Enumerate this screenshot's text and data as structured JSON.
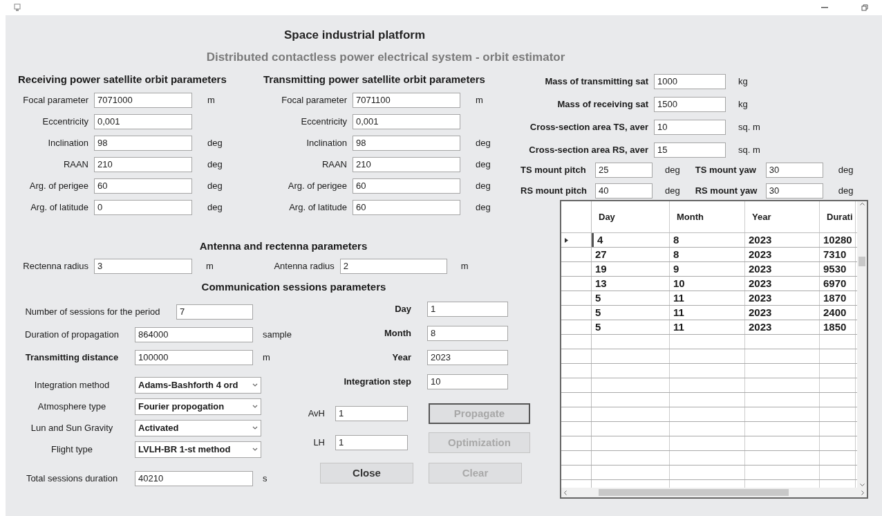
{
  "header": {
    "title": "Space industrial platform",
    "subtitle": "Distributed contactless power electrical system - orbit estimator"
  },
  "receiving": {
    "heading": "Receiving power satellite orbit parameters",
    "fields": [
      {
        "label": "Focal parameter",
        "value": "7071000",
        "unit": "m"
      },
      {
        "label": "Eccentricity",
        "value": "0,001"
      },
      {
        "label": "Inclination",
        "value": "98",
        "unit": "deg"
      },
      {
        "label": "RAAN",
        "value": "210",
        "unit": "deg"
      },
      {
        "label": "Arg. of perigee",
        "value": "60",
        "unit": "deg"
      },
      {
        "label": "Arg. of latitude",
        "value": "0",
        "unit": "deg"
      }
    ]
  },
  "transmitting": {
    "heading": "Transmitting power satellite orbit parameters",
    "fields": [
      {
        "label": "Focal parameter",
        "value": "7071100",
        "unit": "m"
      },
      {
        "label": "Eccentricity",
        "value": "0,001"
      },
      {
        "label": "Inclination",
        "value": "98",
        "unit": "deg"
      },
      {
        "label": "RAAN",
        "value": "210",
        "unit": "deg"
      },
      {
        "label": "Arg. of perigee",
        "value": "60",
        "unit": "deg"
      },
      {
        "label": "Arg. of latitude",
        "value": "60",
        "unit": "deg"
      }
    ]
  },
  "satellite_params": {
    "fields": [
      {
        "label": "Mass of transmitting sat",
        "value": "1000",
        "unit": "kg"
      },
      {
        "label": "Mass of receiving sat",
        "value": "1500",
        "unit": "kg"
      },
      {
        "label": "Cross-section area TS, aver",
        "value": "10",
        "unit": "sq. m"
      },
      {
        "label": "Cross-section area RS, aver",
        "value": "15",
        "unit": "sq. m"
      }
    ],
    "mounts": [
      {
        "label": "TS mount pitch",
        "value": "25",
        "unit": "deg"
      },
      {
        "label": "TS mount yaw",
        "value": "30",
        "unit": "deg"
      },
      {
        "label": "RS mount pitch",
        "value": "40",
        "unit": "deg"
      },
      {
        "label": "RS mount yaw",
        "value": "30",
        "unit": "deg"
      }
    ]
  },
  "antenna": {
    "heading": "Antenna and rectenna parameters",
    "fields": [
      {
        "label": "Rectenna radius",
        "value": "3",
        "unit": "m"
      },
      {
        "label": "Antenna radius",
        "value": "2",
        "unit": "m"
      }
    ]
  },
  "sessions": {
    "heading": "Communication sessions parameters",
    "fields": [
      {
        "label": "Number of sessions for the period",
        "value": "7",
        "bold": false
      },
      {
        "label": "Duration of propagation",
        "value": "864000",
        "unit": "sample",
        "bold": false
      },
      {
        "label": "Transmitting distance",
        "value": "100000",
        "unit": "m",
        "bold": true
      }
    ],
    "selects": [
      {
        "label": "Integration method",
        "value": "Adams-Bashforth 4 ord"
      },
      {
        "label": "Atmosphere type",
        "value": "Fourier propogation"
      },
      {
        "label": "Lun and Sun Gravity",
        "value": "Activated"
      },
      {
        "label": "Flight type",
        "value": "LVLH-BR 1-st method"
      }
    ],
    "total": {
      "label": "Total sessions duration",
      "value": "40210",
      "unit": "s"
    },
    "date_fields": [
      {
        "label": "Day",
        "value": "1"
      },
      {
        "label": "Month",
        "value": "8"
      },
      {
        "label": "Year",
        "value": "2023"
      },
      {
        "label": "Integration step",
        "value": "10"
      }
    ],
    "weights": [
      {
        "label": "AvH",
        "value": "1"
      },
      {
        "label": "LH",
        "value": "1"
      }
    ],
    "side_buttons": [
      {
        "label": "Propagate",
        "disabled": true,
        "default": true
      },
      {
        "label": "Optimization",
        "disabled": true,
        "default": false
      }
    ],
    "bottom_buttons": [
      {
        "label": "Close",
        "disabled": false,
        "default": false
      },
      {
        "label": "Clear",
        "disabled": true,
        "default": false
      }
    ]
  },
  "table": {
    "columns": [
      "Day",
      "Month",
      "Year",
      "Durati"
    ],
    "rows": [
      {
        "selected": true,
        "cells": [
          "4",
          "8",
          "2023",
          "10280"
        ]
      },
      {
        "selected": false,
        "cells": [
          "27",
          "8",
          "2023",
          "7310"
        ]
      },
      {
        "selected": false,
        "cells": [
          "19",
          "9",
          "2023",
          "9530"
        ]
      },
      {
        "selected": false,
        "cells": [
          "13",
          "10",
          "2023",
          "6970"
        ]
      },
      {
        "selected": false,
        "cells": [
          "5",
          "11",
          "2023",
          "1870"
        ]
      },
      {
        "selected": false,
        "cells": [
          "5",
          "11",
          "2023",
          "2400"
        ]
      },
      {
        "selected": false,
        "cells": [
          "5",
          "11",
          "2023",
          "1850"
        ]
      }
    ]
  }
}
